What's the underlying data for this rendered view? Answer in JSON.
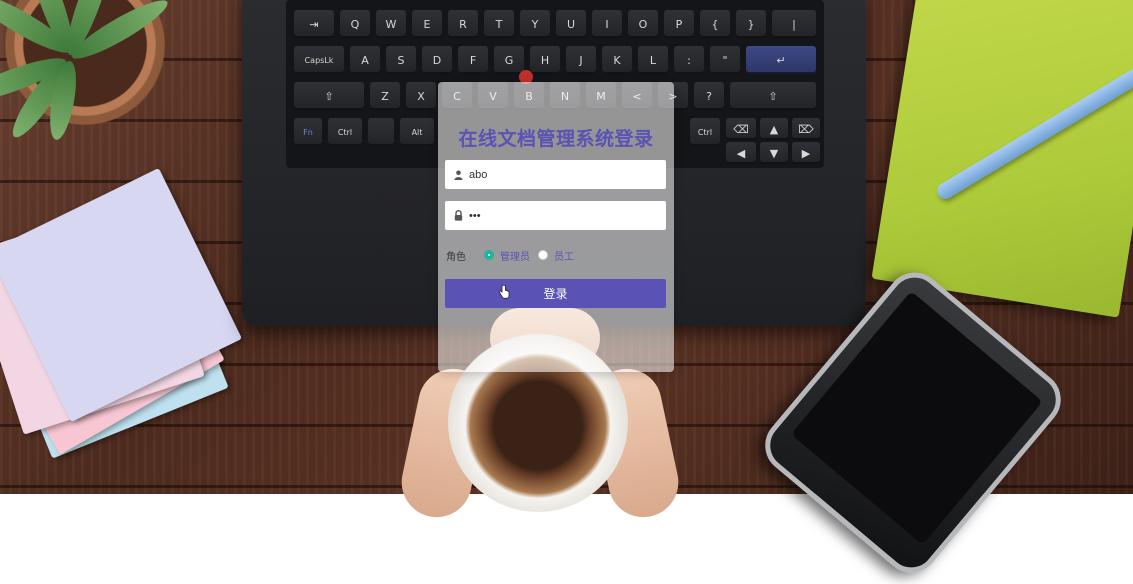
{
  "login": {
    "title": "在线文档管理系统登录",
    "username": {
      "value": "abo",
      "icon": "user-icon"
    },
    "password": {
      "value": "•••",
      "icon": "lock-icon"
    },
    "role": {
      "label": "角色",
      "options": [
        {
          "label": "管理员",
          "selected": true
        },
        {
          "label": "员工",
          "selected": false
        }
      ]
    },
    "submit_label": "登录"
  },
  "colors": {
    "accent": "#5a52b4",
    "radio_checked": "#23b39b"
  }
}
